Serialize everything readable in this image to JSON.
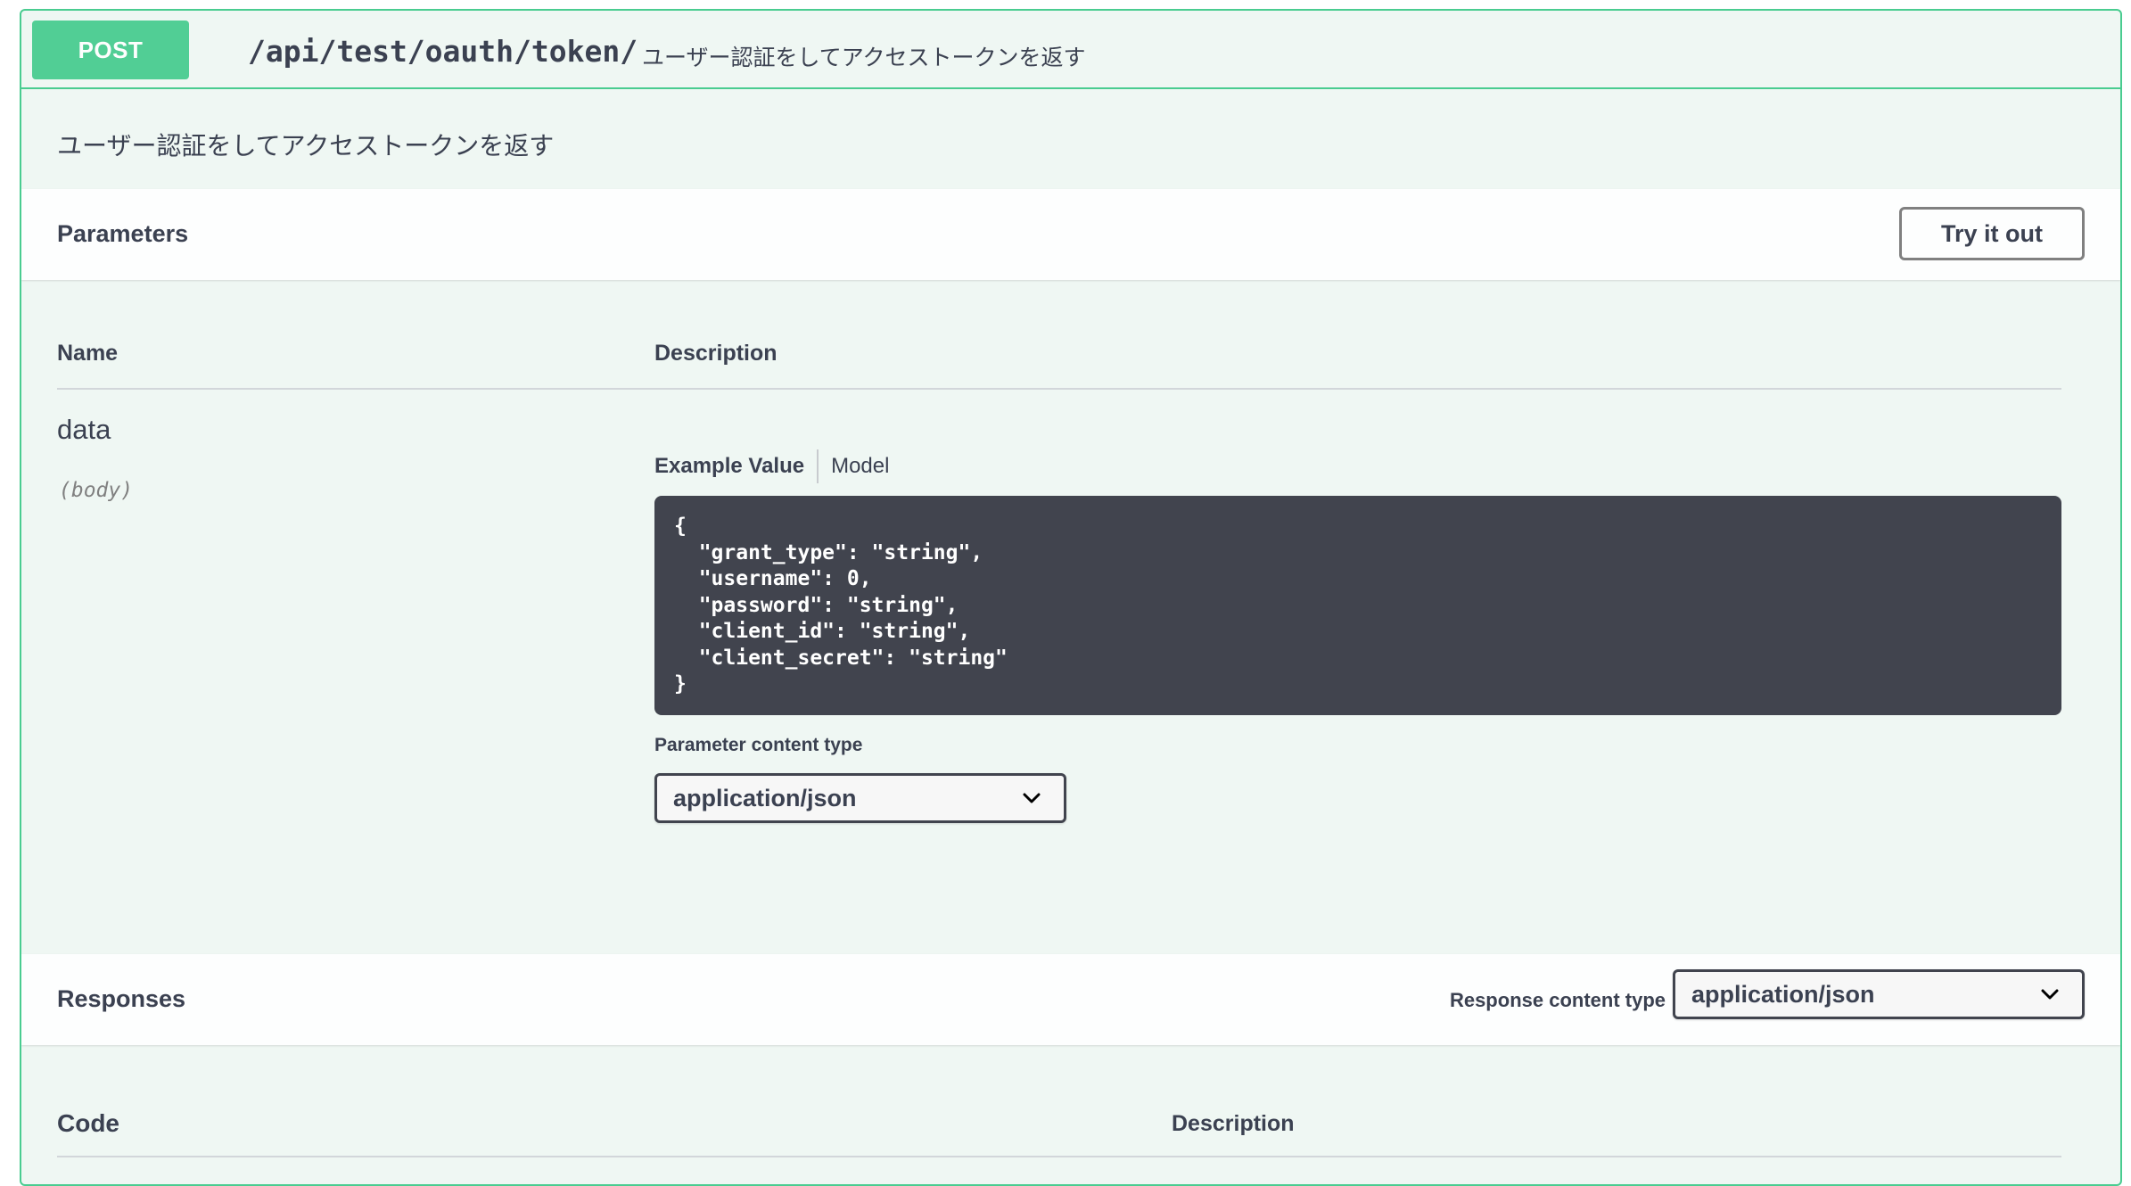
{
  "summary": {
    "method": "POST",
    "path": "/api/test/oauth/token/",
    "description": "ユーザー認証をしてアクセストークンを返す"
  },
  "description": "ユーザー認証をしてアクセストークンを返す",
  "parameters": {
    "title": "Parameters",
    "try_button": "Try it out",
    "columns": {
      "name": "Name",
      "description": "Description"
    },
    "param": {
      "name": "data",
      "in": "(body)",
      "tabs": {
        "example": "Example Value",
        "model": "Model"
      },
      "example_code": "{\n  \"grant_type\": \"string\",\n  \"username\": 0,\n  \"password\": \"string\",\n  \"client_id\": \"string\",\n  \"client_secret\": \"string\"\n}",
      "content_type_label": "Parameter content type",
      "content_type_value": "application/json"
    }
  },
  "responses": {
    "title": "Responses",
    "content_type_label": "Response content type",
    "content_type_value": "application/json",
    "columns": {
      "code": "Code",
      "description": "Description"
    }
  },
  "colors": {
    "post_green": "#49cc90",
    "block_bg": "#eff7f3",
    "code_bg": "#41444e",
    "text": "#3b4151"
  },
  "icons": {
    "select_chevron": "chevron-down-icon"
  }
}
